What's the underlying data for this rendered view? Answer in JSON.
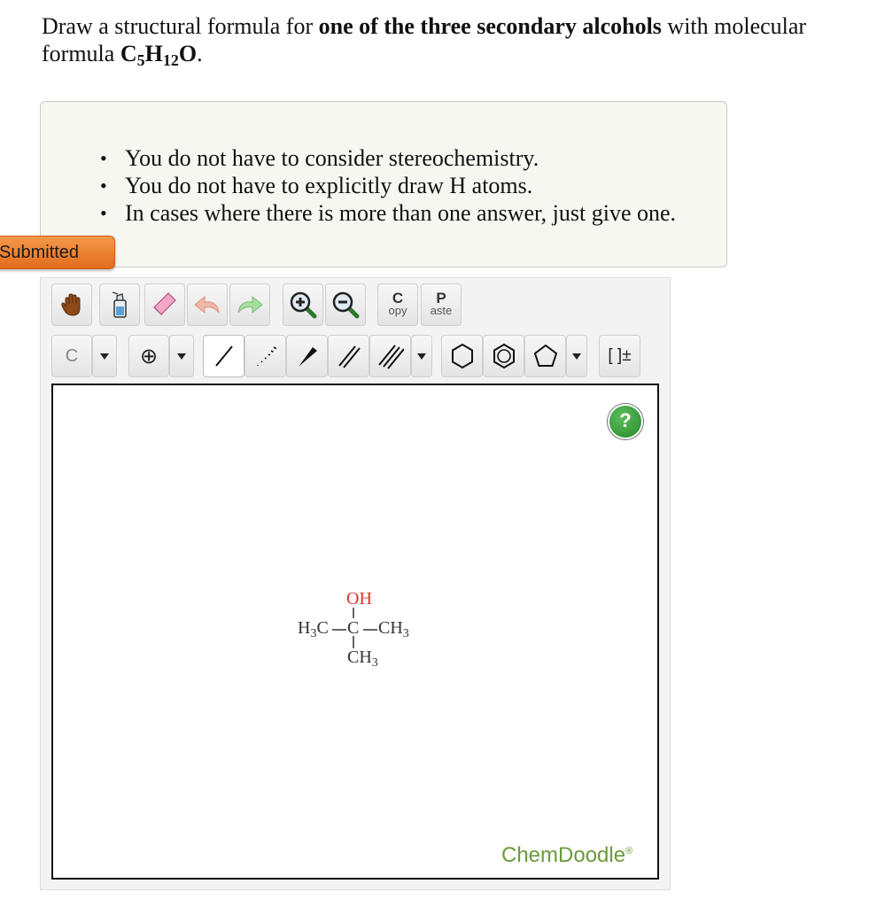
{
  "question": {
    "prefix": "Draw a structural formula for ",
    "bold": "one of the three secondary alcohols",
    "middle": " with molecular formula ",
    "formula": {
      "c": "C",
      "c_sub": "5",
      "h": "H",
      "h_sub": "12",
      "o": "O"
    },
    "suffix": "."
  },
  "hints": [
    "You do not have to consider stereochemistry.",
    "You do not have to explicitly draw H atoms.",
    "In cases where there is more than one answer, just give one."
  ],
  "status": {
    "label": "Submitted"
  },
  "toolbar": {
    "copy": {
      "big": "C",
      "small": "opy"
    },
    "paste": {
      "big": "P",
      "small": "aste"
    },
    "atom_label": "C",
    "charge_label": "⊕",
    "bracket_label": "[ ]±"
  },
  "canvas": {
    "help": "?",
    "brand": "ChemDoodle",
    "brand_mark": "®",
    "molecule": {
      "oh": "OH",
      "left_h": "H",
      "left_h_sub": "3",
      "left_c": "C",
      "center_c": "C",
      "right_c": "CH",
      "right_sub": "3",
      "bottom_c": "CH",
      "bottom_sub": "3"
    }
  },
  "colors": {
    "submitted": "#e8782a",
    "brand": "#6a9a3a",
    "oxygen": "#e03030",
    "help": "#2f8f2f"
  }
}
